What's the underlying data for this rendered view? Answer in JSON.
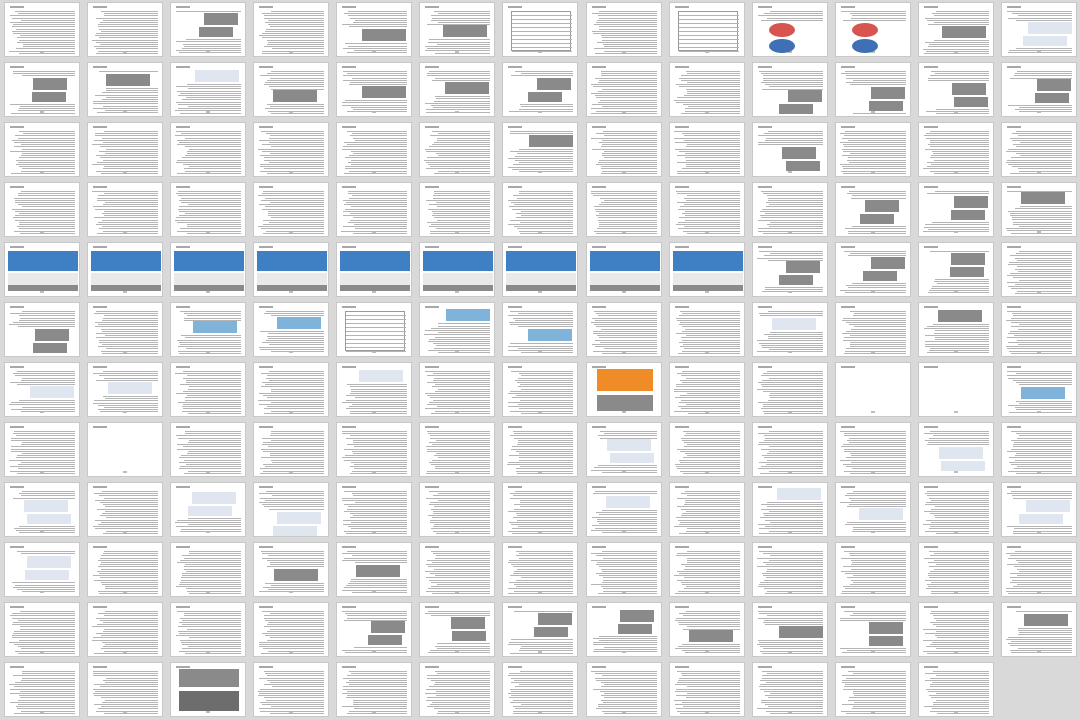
{
  "document": {
    "view": "thumbnail-grid",
    "columns": 13,
    "rows": 12,
    "page_count": 155,
    "pages": [
      {
        "p": 1,
        "t": "text"
      },
      {
        "p": 2,
        "t": "text"
      },
      {
        "p": 3,
        "t": "text",
        "img": "photos"
      },
      {
        "p": 4,
        "t": "text"
      },
      {
        "p": 5,
        "t": "text",
        "img": "photo"
      },
      {
        "p": 6,
        "t": "text",
        "img": "photo"
      },
      {
        "p": 7,
        "t": "table"
      },
      {
        "p": 8,
        "t": "text"
      },
      {
        "p": 9,
        "t": "table"
      },
      {
        "p": 10,
        "t": "chart",
        "img": "pie-charts"
      },
      {
        "p": 11,
        "t": "chart",
        "img": "pie-chart"
      },
      {
        "p": 12,
        "t": "text",
        "img": "photo"
      },
      {
        "p": 13,
        "t": "text",
        "img": "figures"
      },
      {
        "p": 14,
        "t": "text",
        "img": "photos"
      },
      {
        "p": 15,
        "t": "text",
        "img": "photo"
      },
      {
        "p": 16,
        "t": "text",
        "img": "figure"
      },
      {
        "p": 17,
        "t": "text",
        "img": "photo"
      },
      {
        "p": 18,
        "t": "text",
        "img": "photo"
      },
      {
        "p": 19,
        "t": "text",
        "img": "photo"
      },
      {
        "p": 20,
        "t": "text",
        "img": "photos"
      },
      {
        "p": 21,
        "t": "text"
      },
      {
        "p": 22,
        "t": "text"
      },
      {
        "p": 23,
        "t": "text",
        "img": "photos"
      },
      {
        "p": 24,
        "t": "text",
        "img": "photos"
      },
      {
        "p": 25,
        "t": "text",
        "img": "photos"
      },
      {
        "p": 26,
        "t": "text",
        "img": "photos"
      },
      {
        "p": 27,
        "t": "text"
      },
      {
        "p": 28,
        "t": "text"
      },
      {
        "p": 29,
        "t": "text"
      },
      {
        "p": 30,
        "t": "text"
      },
      {
        "p": 31,
        "t": "text"
      },
      {
        "p": 32,
        "t": "text"
      },
      {
        "p": 33,
        "t": "text",
        "img": "photo"
      },
      {
        "p": 34,
        "t": "text"
      },
      {
        "p": 35,
        "t": "text"
      },
      {
        "p": 36,
        "t": "text",
        "img": "photos"
      },
      {
        "p": 37,
        "t": "text"
      },
      {
        "p": 38,
        "t": "text"
      },
      {
        "p": 39,
        "t": "text"
      },
      {
        "p": 40,
        "t": "text"
      },
      {
        "p": 41,
        "t": "text"
      },
      {
        "p": 42,
        "t": "text"
      },
      {
        "p": 43,
        "t": "text"
      },
      {
        "p": 44,
        "t": "text"
      },
      {
        "p": 45,
        "t": "text"
      },
      {
        "p": 46,
        "t": "text"
      },
      {
        "p": 47,
        "t": "text"
      },
      {
        "p": 48,
        "t": "text"
      },
      {
        "p": 49,
        "t": "text"
      },
      {
        "p": 50,
        "t": "text",
        "img": "photos"
      },
      {
        "p": 51,
        "t": "text",
        "img": "photos"
      },
      {
        "p": 52,
        "t": "text",
        "img": "photo"
      },
      {
        "p": 53,
        "t": "image",
        "img": "architecture"
      },
      {
        "p": 54,
        "t": "image",
        "img": "architecture"
      },
      {
        "p": 55,
        "t": "image",
        "img": "architecture"
      },
      {
        "p": 56,
        "t": "image",
        "img": "architecture"
      },
      {
        "p": 57,
        "t": "image",
        "img": "architecture"
      },
      {
        "p": 58,
        "t": "image",
        "img": "architecture"
      },
      {
        "p": 59,
        "t": "image",
        "img": "architecture"
      },
      {
        "p": 60,
        "t": "image",
        "img": "architecture"
      },
      {
        "p": 61,
        "t": "image",
        "img": "architecture"
      },
      {
        "p": 62,
        "t": "text",
        "img": "photos"
      },
      {
        "p": 63,
        "t": "text",
        "img": "photos"
      },
      {
        "p": 64,
        "t": "text",
        "img": "photos"
      },
      {
        "p": 65,
        "t": "text"
      },
      {
        "p": 66,
        "t": "text",
        "img": "photos"
      },
      {
        "p": 67,
        "t": "text"
      },
      {
        "p": 68,
        "t": "text",
        "img": "map"
      },
      {
        "p": 69,
        "t": "text",
        "img": "map"
      },
      {
        "p": 70,
        "t": "table"
      },
      {
        "p": 71,
        "t": "text",
        "img": "map"
      },
      {
        "p": 72,
        "t": "text",
        "img": "map"
      },
      {
        "p": 73,
        "t": "text"
      },
      {
        "p": 74,
        "t": "text"
      },
      {
        "p": 75,
        "t": "text",
        "img": "plan"
      },
      {
        "p": 76,
        "t": "text"
      },
      {
        "p": 77,
        "t": "text",
        "img": "photo"
      },
      {
        "p": 78,
        "t": "text"
      },
      {
        "p": 79,
        "t": "text",
        "img": "figure"
      },
      {
        "p": 80,
        "t": "text",
        "img": "figure"
      },
      {
        "p": 81,
        "t": "text"
      },
      {
        "p": 82,
        "t": "text"
      },
      {
        "p": 83,
        "t": "text",
        "img": "figure"
      },
      {
        "p": 84,
        "t": "text"
      },
      {
        "p": 85,
        "t": "text"
      },
      {
        "p": 86,
        "t": "image",
        "img": "heatmap"
      },
      {
        "p": 87,
        "t": "text"
      },
      {
        "p": 88,
        "t": "text"
      },
      {
        "p": 89,
        "t": "blank"
      },
      {
        "p": 90,
        "t": "blank"
      },
      {
        "p": 91,
        "t": "text",
        "img": "map"
      },
      {
        "p": 92,
        "t": "text"
      },
      {
        "p": 93,
        "t": "blank"
      },
      {
        "p": 94,
        "t": "text"
      },
      {
        "p": 95,
        "t": "text"
      },
      {
        "p": 96,
        "t": "text"
      },
      {
        "p": 97,
        "t": "text"
      },
      {
        "p": 98,
        "t": "text"
      },
      {
        "p": 99,
        "t": "text",
        "img": "figures"
      },
      {
        "p": 100,
        "t": "text"
      },
      {
        "p": 101,
        "t": "text"
      },
      {
        "p": 102,
        "t": "text"
      },
      {
        "p": 103,
        "t": "text",
        "img": "figures"
      },
      {
        "p": 104,
        "t": "text"
      },
      {
        "p": 105,
        "t": "text",
        "img": "figures"
      },
      {
        "p": 106,
        "t": "text"
      },
      {
        "p": 107,
        "t": "text",
        "img": "figures"
      },
      {
        "p": 108,
        "t": "text",
        "img": "figures"
      },
      {
        "p": 109,
        "t": "text"
      },
      {
        "p": 110,
        "t": "text"
      },
      {
        "p": 111,
        "t": "text"
      },
      {
        "p": 112,
        "t": "text",
        "img": "figure"
      },
      {
        "p": 113,
        "t": "text"
      },
      {
        "p": 114,
        "t": "text",
        "img": "figure"
      },
      {
        "p": 115,
        "t": "text",
        "img": "figure"
      },
      {
        "p": 116,
        "t": "text"
      },
      {
        "p": 117,
        "t": "text",
        "img": "figures"
      },
      {
        "p": 118,
        "t": "text",
        "img": "figures"
      },
      {
        "p": 119,
        "t": "text"
      },
      {
        "p": 120,
        "t": "text"
      },
      {
        "p": 121,
        "t": "text",
        "img": "photo"
      },
      {
        "p": 122,
        "t": "text",
        "img": "photo"
      },
      {
        "p": 123,
        "t": "text"
      },
      {
        "p": 124,
        "t": "text"
      },
      {
        "p": 125,
        "t": "text"
      },
      {
        "p": 126,
        "t": "text"
      },
      {
        "p": 127,
        "t": "text"
      },
      {
        "p": 128,
        "t": "text"
      },
      {
        "p": 129,
        "t": "text"
      },
      {
        "p": 130,
        "t": "text"
      },
      {
        "p": 131,
        "t": "text"
      },
      {
        "p": 132,
        "t": "text"
      },
      {
        "p": 133,
        "t": "text"
      },
      {
        "p": 134,
        "t": "text"
      },
      {
        "p": 135,
        "t": "text",
        "img": "photos"
      },
      {
        "p": 136,
        "t": "text",
        "img": "photos"
      },
      {
        "p": 137,
        "t": "text",
        "img": "photos"
      },
      {
        "p": 138,
        "t": "text",
        "img": "photos"
      },
      {
        "p": 139,
        "t": "text",
        "img": "photo"
      },
      {
        "p": 140,
        "t": "text",
        "img": "photo"
      },
      {
        "p": 141,
        "t": "text",
        "img": "photos"
      },
      {
        "p": 142,
        "t": "text"
      },
      {
        "p": 143,
        "t": "text",
        "img": "photo"
      },
      {
        "p": 144,
        "t": "text"
      },
      {
        "p": 145,
        "t": "text"
      },
      {
        "p": 146,
        "t": "image",
        "img": "photos"
      },
      {
        "p": 147,
        "t": "text"
      },
      {
        "p": 148,
        "t": "text"
      },
      {
        "p": 149,
        "t": "text"
      },
      {
        "p": 150,
        "t": "text"
      },
      {
        "p": 151,
        "t": "text"
      },
      {
        "p": 152,
        "t": "text"
      },
      {
        "p": 153,
        "t": "text"
      },
      {
        "p": 154,
        "t": "text"
      },
      {
        "p": 155,
        "t": "text"
      },
      {
        "p": 156,
        "t": "blank-slot"
      }
    ]
  },
  "colors": {
    "background": "#d9d9d9",
    "page": "#ffffff",
    "text_line": "#b4b4b4",
    "photo_gray": "#8a8a8a",
    "sky_blue": "#3f7fc4",
    "orange": "#f08c28",
    "chart_red": "#d9534f",
    "chart_blue": "#3f6fb5"
  }
}
